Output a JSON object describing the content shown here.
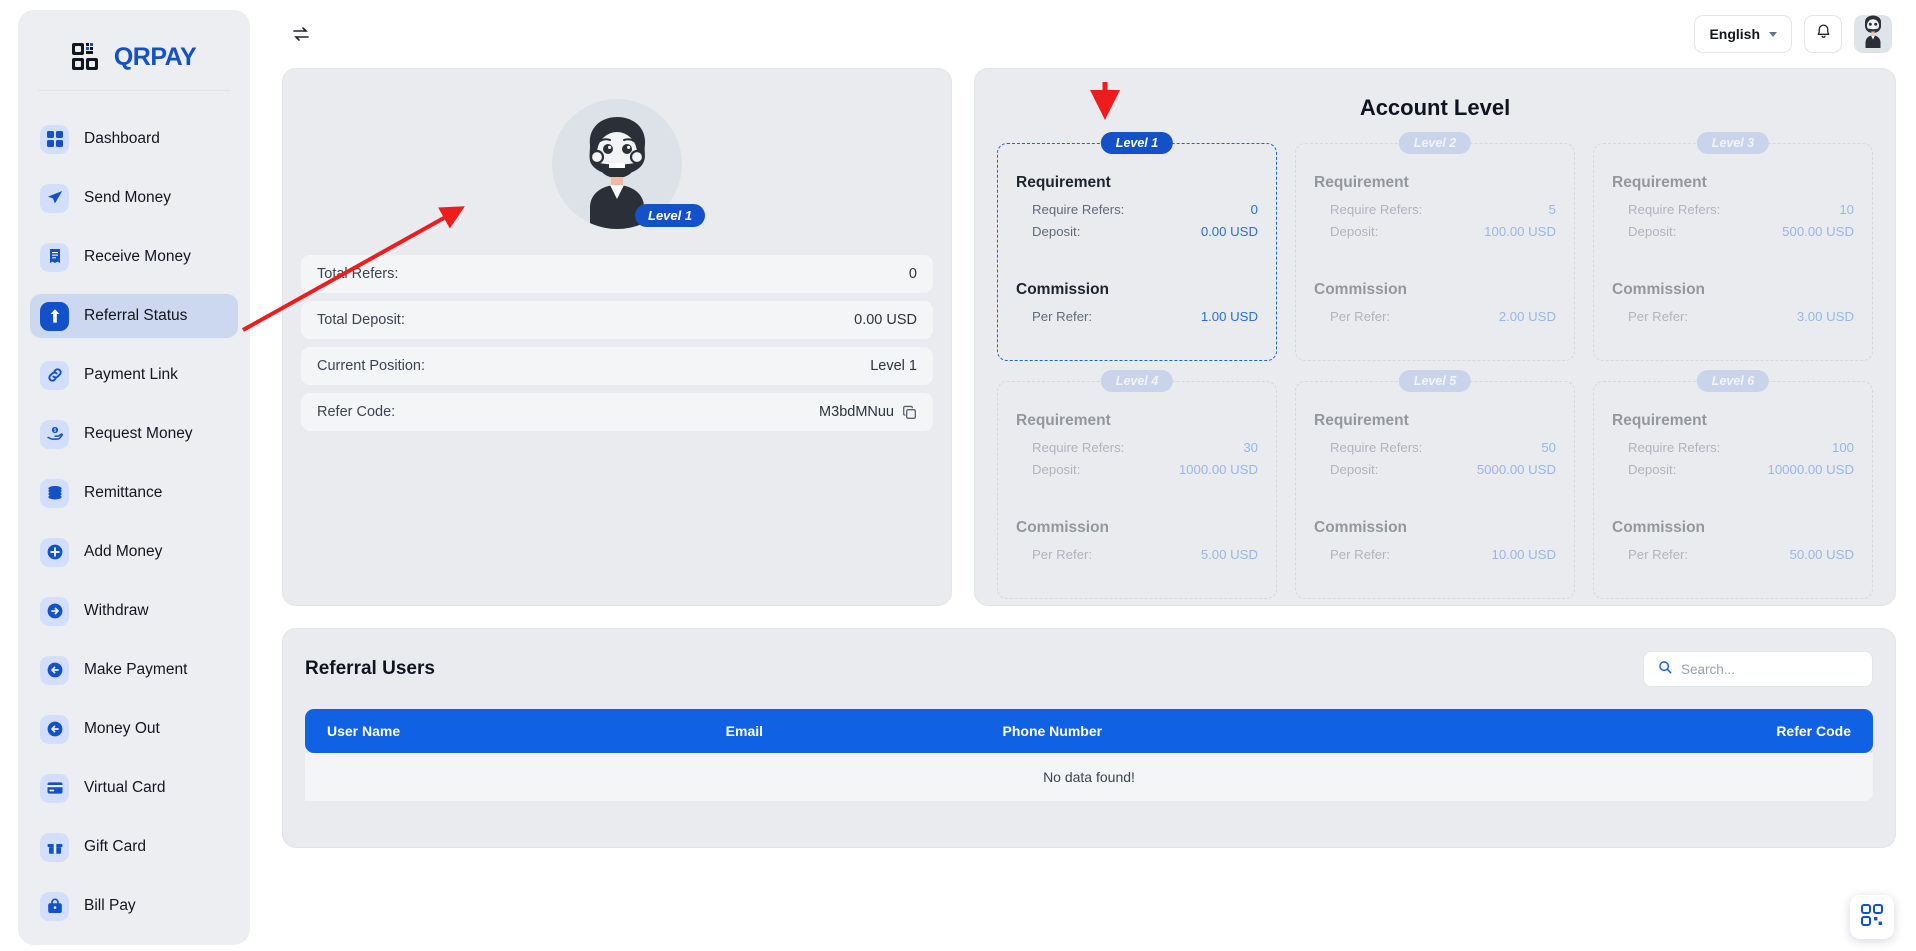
{
  "brand": {
    "name": "QRPAY",
    "logo_icon": "qr-code-icon"
  },
  "sidebar": {
    "items": [
      {
        "label": "Dashboard",
        "icon": "grid-icon",
        "active": false
      },
      {
        "label": "Send Money",
        "icon": "send-icon",
        "active": false
      },
      {
        "label": "Receive Money",
        "icon": "receipt-icon",
        "active": false
      },
      {
        "label": "Referral Status",
        "icon": "up-arrow-icon",
        "active": true
      },
      {
        "label": "Payment Link",
        "icon": "link-icon",
        "active": false
      },
      {
        "label": "Request Money",
        "icon": "hand-money-icon",
        "active": false
      },
      {
        "label": "Remittance",
        "icon": "coins-icon",
        "active": false
      },
      {
        "label": "Add Money",
        "icon": "plus-circle-icon",
        "active": false
      },
      {
        "label": "Withdraw",
        "icon": "arrow-right-circle-icon",
        "active": false
      },
      {
        "label": "Make Payment",
        "icon": "arrow-left-circle-icon",
        "active": false
      },
      {
        "label": "Money Out",
        "icon": "arrow-left-circle-icon",
        "active": false
      },
      {
        "label": "Virtual Card",
        "icon": "credit-card-icon",
        "active": false
      },
      {
        "label": "Gift Card",
        "icon": "gift-icon",
        "active": false
      },
      {
        "label": "Bill Pay",
        "icon": "bag-icon",
        "active": false
      }
    ]
  },
  "topbar": {
    "collapse_icon": "sidebar-toggle-icon",
    "language": "English",
    "bell_icon": "bell-icon",
    "avatar_icon": "user-avatar-icon"
  },
  "profile": {
    "avatar_icon": "user-avatar-icon",
    "level_badge": "Level 1",
    "rows": [
      {
        "label": "Total Refers:",
        "value": "0",
        "copy": false
      },
      {
        "label": "Total Deposit:",
        "value": "0.00 USD",
        "copy": false
      },
      {
        "label": "Current Position:",
        "value": "Level 1",
        "copy": false
      },
      {
        "label": "Refer Code:",
        "value": "M3bdMNuu",
        "copy": true
      }
    ],
    "copy_icon": "copy-icon"
  },
  "account_level": {
    "title": "Account Level",
    "requirement_heading": "Requirement",
    "commission_heading": "Commission",
    "require_refers_label": "Require Refers:",
    "deposit_label": "Deposit:",
    "per_refer_label": "Per Refer:",
    "levels": [
      {
        "tag": "Level 1",
        "require_refers": "0",
        "deposit": "0.00 USD",
        "per_refer": "1.00 USD",
        "current": true
      },
      {
        "tag": "Level 2",
        "require_refers": "5",
        "deposit": "100.00 USD",
        "per_refer": "2.00 USD",
        "current": false
      },
      {
        "tag": "Level 3",
        "require_refers": "10",
        "deposit": "500.00 USD",
        "per_refer": "3.00 USD",
        "current": false
      },
      {
        "tag": "Level 4",
        "require_refers": "30",
        "deposit": "1000.00 USD",
        "per_refer": "5.00 USD",
        "current": false
      },
      {
        "tag": "Level 5",
        "require_refers": "50",
        "deposit": "5000.00 USD",
        "per_refer": "10.00 USD",
        "current": false
      },
      {
        "tag": "Level 6",
        "require_refers": "100",
        "deposit": "10000.00 USD",
        "per_refer": "50.00 USD",
        "current": false
      }
    ]
  },
  "referral_users": {
    "title": "Referral Users",
    "search_placeholder": "Search...",
    "search_value": "",
    "search_icon": "search-icon",
    "columns": [
      "User Name",
      "Email",
      "Phone Number",
      "Refer Code"
    ],
    "empty_text": "No data found!"
  },
  "fab": {
    "icon": "qr-scan-icon"
  },
  "colors": {
    "accent": "#1450c8",
    "table_header": "#1161e4",
    "value_blue": "#2a6ee0",
    "annotation_red": "#ee1c1c",
    "sidebar_bg": "#eceef2",
    "card_bg": "#e9ebee"
  }
}
